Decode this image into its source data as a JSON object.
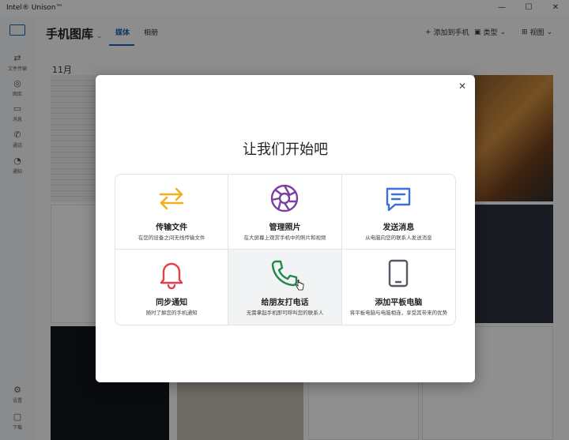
{
  "window": {
    "title": "Intel® Unison™",
    "controls": [
      "—",
      "☐",
      "✕"
    ]
  },
  "sidebar": {
    "items": [
      {
        "label": "文件传输",
        "icon": "transfer-icon",
        "glyph": "⇄"
      },
      {
        "label": "图库",
        "icon": "gallery-icon",
        "glyph": "◎"
      },
      {
        "label": "消息",
        "icon": "message-icon",
        "glyph": "▭"
      },
      {
        "label": "通话",
        "icon": "phone-icon",
        "glyph": "✆"
      },
      {
        "label": "通知",
        "icon": "bell-icon",
        "glyph": "◔"
      }
    ],
    "bottom": [
      {
        "label": "设置",
        "icon": "gear-icon",
        "glyph": "⚙"
      },
      {
        "label": "下载",
        "icon": "folder-icon",
        "glyph": "▢"
      }
    ]
  },
  "header": {
    "title": "手机图库",
    "title_chevron": "⌄",
    "tabs": [
      {
        "label": "媒体",
        "active": true
      },
      {
        "label": "相册",
        "active": false
      }
    ],
    "actions": [
      {
        "label": "添加到手机",
        "glyph": "+"
      },
      {
        "label": "类型",
        "glyph": "▣"
      },
      {
        "label": "视图",
        "glyph": "⊞"
      }
    ]
  },
  "gallery": {
    "month": "11月"
  },
  "modal": {
    "close": "✕",
    "heading": "让我们开始吧",
    "cards": [
      {
        "title": "传输文件",
        "desc": "在您的设备之间无线传输文件",
        "icon": "transfer-arrows-icon",
        "color": "#f2b01e"
      },
      {
        "title": "管理照片",
        "desc": "在大屏幕上观赏手机中的照片和视频",
        "icon": "aperture-icon",
        "color": "#7b3fa0"
      },
      {
        "title": "发送消息",
        "desc": "从电脑向您的联系人发送消息",
        "icon": "chat-bubble-icon",
        "color": "#3b6fd9"
      },
      {
        "title": "同步通知",
        "desc": "随时了解您的手机通知",
        "icon": "bell-icon",
        "color": "#e0404a"
      },
      {
        "title": "给朋友打电话",
        "desc": "无需拿起手机即可呼叫您的联系人",
        "icon": "phone-icon",
        "color": "#1f8a4c"
      },
      {
        "title": "添加平板电脑",
        "desc": "将平板电脑与电脑相连，享受其带来的优势",
        "icon": "tablet-icon",
        "color": "#555b66"
      }
    ]
  },
  "colors": {
    "accent": "#1b5fa8",
    "overlay": "rgba(0,0,0,0.42)"
  }
}
